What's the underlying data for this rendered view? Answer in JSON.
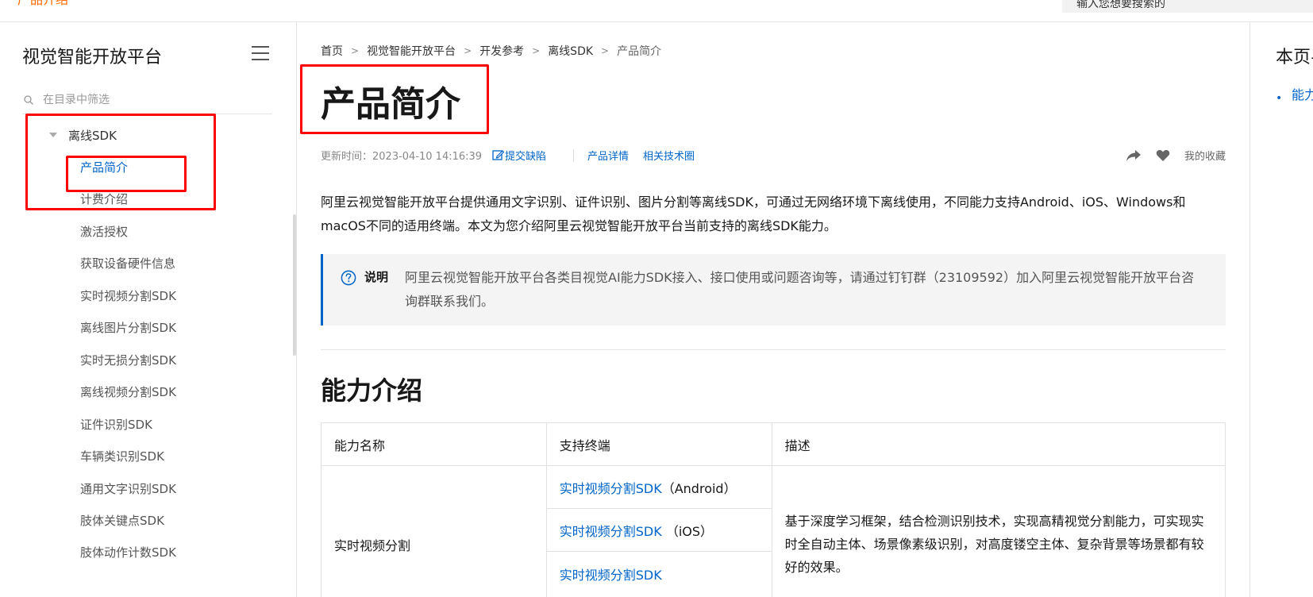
{
  "topbar": {
    "brand": "产品介绍",
    "search_text": "输入您想要搜索的"
  },
  "sidebar": {
    "title": "视觉智能开放平台",
    "filter_placeholder": "在目录中筛选",
    "group_label": "离线SDK",
    "items": [
      {
        "label": "产品简介"
      },
      {
        "label": "计费介绍"
      },
      {
        "label": "激活授权"
      },
      {
        "label": "获取设备硬件信息"
      },
      {
        "label": "实时视频分割SDK"
      },
      {
        "label": "离线图片分割SDK"
      },
      {
        "label": "实时无损分割SDK"
      },
      {
        "label": "离线视频分割SDK"
      },
      {
        "label": "证件识别SDK"
      },
      {
        "label": "车辆类识别SDK"
      },
      {
        "label": "通用文字识别SDK"
      },
      {
        "label": "肢体关键点SDK"
      },
      {
        "label": "肢体动作计数SDK"
      }
    ]
  },
  "breadcrumb": {
    "items": [
      "首页",
      "视觉智能开放平台",
      "开发参考",
      "离线SDK"
    ],
    "current": "产品简介"
  },
  "page": {
    "title": "产品简介",
    "updated": "更新时间：2023-04-10 14:16:39",
    "report_issue": "提交缺陷",
    "product_detail": "产品详情",
    "tech_circle": "相关技术圈",
    "favorites": "我的收藏",
    "intro": "阿里云视觉智能开放平台提供通用文字识别、证件识别、图片分割等离线SDK，可通过无网络环境下离线使用，不同能力支持Android、iOS、Windows和macOS不同的适用终端。本文为您介绍阿里云视觉智能开放平台当前支持的离线SDK能力。",
    "note_label": "说明",
    "note_text": "阿里云视觉智能开放平台各类目视觉AI能力SDK接入、接口使用或问题咨询等，请通过钉钉群（23109592）加入阿里云视觉智能开放平台咨询群联系我们。",
    "section_title": "能力介绍"
  },
  "table": {
    "headers": [
      "能力名称",
      "支持终端",
      "描述"
    ],
    "rows": [
      {
        "name": "实时视频分割",
        "terminals": [
          {
            "link": "实时视频分割SDK",
            "suffix": "（Android）"
          },
          {
            "link": "实时视频分割SDK",
            "suffix": "（iOS）"
          },
          {
            "link": "实时视频分割SDK",
            "suffix": ""
          }
        ],
        "description": "基于深度学习框架，结合检测识别技术，实现高精视觉分割能力，可实现实时全自动主体、场景像素级识别，对高度镂空主体、复杂背景等场景都有较好的效果。"
      }
    ]
  },
  "toc": {
    "title": "本页导读",
    "items": [
      {
        "label": "能力介绍"
      }
    ]
  },
  "colors": {
    "accent": "#0064c8",
    "brand": "#ff6a00",
    "annotation": "#ff0000"
  }
}
